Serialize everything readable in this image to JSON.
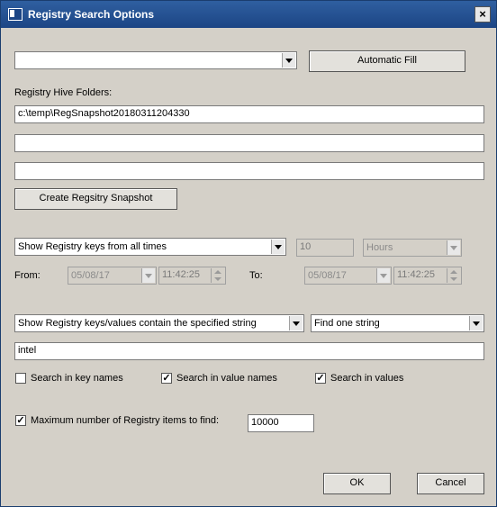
{
  "window": {
    "title": "Registry Search Options",
    "close_glyph": "×"
  },
  "profile_combo": {
    "value": ""
  },
  "automatic_fill_label": "Automatic Fill",
  "hive_folders": {
    "label": "Registry Hive Folders:",
    "fields": [
      "c:\\temp\\RegSnapshot20180311204330",
      "",
      ""
    ]
  },
  "create_snapshot_label": "Create Regsitry Snapshot",
  "time_filter": {
    "mode": "Show Registry keys from all times",
    "amount": "10",
    "unit": "Hours",
    "from_label": "From:",
    "to_label": "To:",
    "from_date": "05/08/17",
    "from_time": "11:42:25",
    "to_date": "05/08/17",
    "to_time": "11:42:25"
  },
  "string_filter": {
    "mode": "Show Registry keys/values contain the specified string",
    "find_mode": "Find one string",
    "search_text": "intel"
  },
  "search_scope": {
    "key_names_label": "Search in key names",
    "key_names_checked": false,
    "value_names_label": "Search in value names",
    "value_names_checked": true,
    "values_label": "Search in values",
    "values_checked": true
  },
  "max_items": {
    "label": "Maximum number of Registry items to find:",
    "checked": true,
    "value": "10000"
  },
  "buttons": {
    "ok": "OK",
    "cancel": "Cancel"
  },
  "check_glyph": "✓",
  "colors": {
    "titlebar": "#1c4585",
    "dialog_bg": "#d4d0c8"
  }
}
